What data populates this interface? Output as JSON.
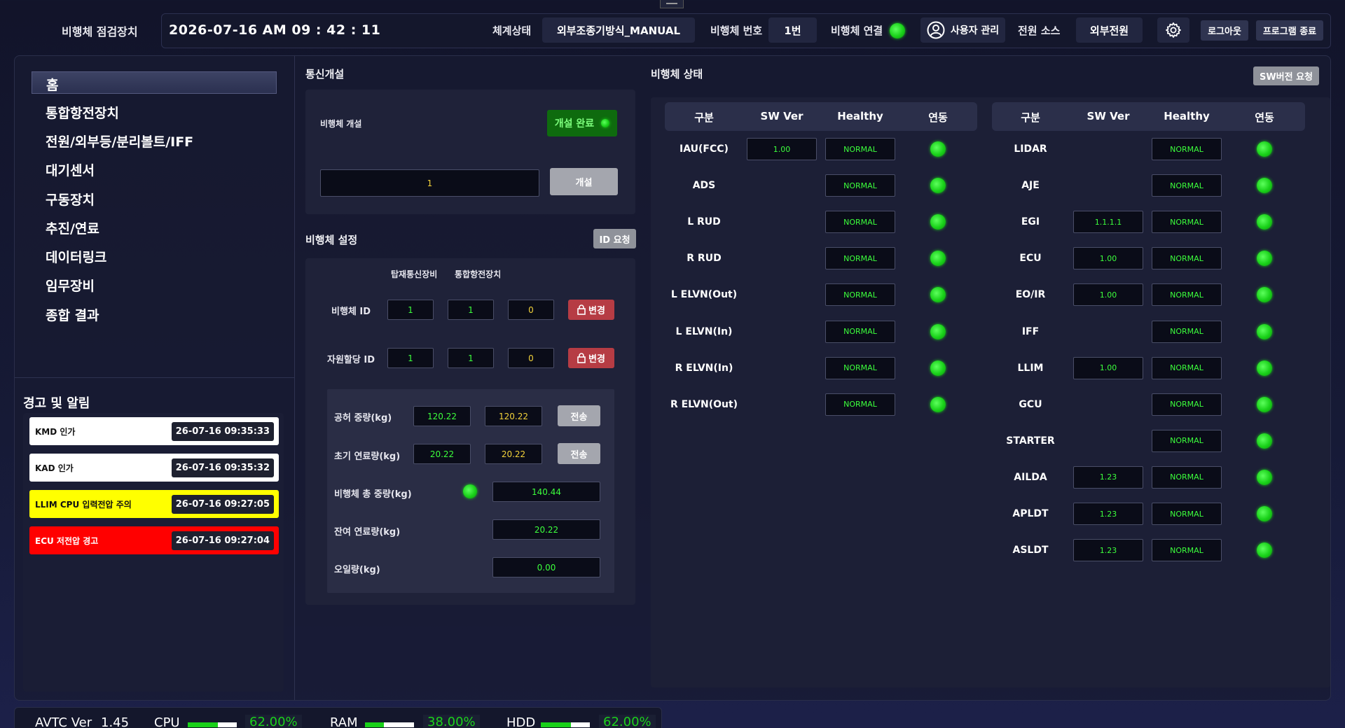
{
  "header": {
    "app_title": "비행체 점검장치",
    "datetime": "2026-07-16   AM 09 : 42 : 11",
    "system_state_label": "체계상태",
    "system_state_value": "외부조종기방식_MANUAL",
    "vehicle_no_label": "비행체 번호",
    "vehicle_no_value": "1번",
    "vehicle_link_label": "비행체 연결",
    "user_mgmt_label": "사용자 관리",
    "power_source_label": "전원 소스",
    "power_source_value": "외부전원",
    "logout_label": "로그아웃",
    "exit_label": "프로그램 종료"
  },
  "sidebar": {
    "items": [
      {
        "label": "홈"
      },
      {
        "label": "통합항전장치"
      },
      {
        "label": "전원/외부등/분리볼트/IFF"
      },
      {
        "label": "대기센서"
      },
      {
        "label": "구동장치"
      },
      {
        "label": "추진/연료"
      },
      {
        "label": "데이터링크"
      },
      {
        "label": "임무장비"
      },
      {
        "label": "종합 결과"
      }
    ]
  },
  "alerts": {
    "title": "경고 및 알림",
    "items": [
      {
        "text": "KMD 인가",
        "time": "26-07-16 09:35:33",
        "level": "white"
      },
      {
        "text": "KAD 인가",
        "time": "26-07-16 09:35:32",
        "level": "white"
      },
      {
        "text": "LLIM CPU 입력전압 주의",
        "time": "26-07-16 09:27:05",
        "level": "yellow"
      },
      {
        "text": "ECU 저전압 경고",
        "time": "26-07-16 09:27:04",
        "level": "red"
      }
    ]
  },
  "comm": {
    "title": "통신개설",
    "vehicle_open_label": "비행체 개설",
    "status_label": "개설 완료",
    "input_value": "1",
    "open_button": "개설"
  },
  "vehicle_setup": {
    "title": "비행체 설정",
    "id_request_button": "ID 요청",
    "col1_header": "탑재통신장비",
    "col2_header": "통합항전장치",
    "vehicle_id_label": "비행체 ID",
    "vehicle_id_values": [
      "1",
      "1",
      "0"
    ],
    "resource_id_label": "자원할당 ID",
    "resource_id_values": [
      "1",
      "1",
      "0"
    ],
    "change_button": "변경",
    "empty_weight_label": "공허 중량(kg)",
    "empty_weight_values": [
      "120.22",
      "120.22"
    ],
    "init_fuel_label": "초기 연료량(kg)",
    "init_fuel_values": [
      "20.22",
      "20.22"
    ],
    "send_button": "전송",
    "total_weight_label": "비행체 총 중량(kg)",
    "total_weight_value": "140.44",
    "remaining_fuel_label": "잔여 연료량(kg)",
    "remaining_fuel_value": "20.22",
    "oil_label": "오일량(kg)",
    "oil_value": "0.00"
  },
  "vehicle_status": {
    "title": "비행체 상태",
    "sw_request_button": "SW버전 요청",
    "headers": [
      "구분",
      "SW Ver",
      "Healthy",
      "연동"
    ],
    "left_rows": [
      {
        "name": "IAU(FCC)",
        "sw": "1.00",
        "health": "NORMAL"
      },
      {
        "name": "ADS",
        "sw": "",
        "health": "NORMAL"
      },
      {
        "name": "L RUD",
        "sw": "",
        "health": "NORMAL"
      },
      {
        "name": "R RUD",
        "sw": "",
        "health": "NORMAL"
      },
      {
        "name": "L ELVN(Out)",
        "sw": "",
        "health": "NORMAL"
      },
      {
        "name": "L ELVN(In)",
        "sw": "",
        "health": "NORMAL"
      },
      {
        "name": "R ELVN(In)",
        "sw": "",
        "health": "NORMAL"
      },
      {
        "name": "R ELVN(Out)",
        "sw": "",
        "health": "NORMAL"
      }
    ],
    "right_rows": [
      {
        "name": "LIDAR",
        "sw": "",
        "health": "NORMAL"
      },
      {
        "name": "AJE",
        "sw": "",
        "health": "NORMAL"
      },
      {
        "name": "EGI",
        "sw": "1.1.1.1",
        "health": "NORMAL"
      },
      {
        "name": "ECU",
        "sw": "1.00",
        "health": "NORMAL"
      },
      {
        "name": "EO/IR",
        "sw": "1.00",
        "health": "NORMAL"
      },
      {
        "name": "IFF",
        "sw": "",
        "health": "NORMAL"
      },
      {
        "name": "LLIM",
        "sw": "1.00",
        "health": "NORMAL"
      },
      {
        "name": "GCU",
        "sw": "",
        "health": "NORMAL"
      },
      {
        "name": "STARTER",
        "sw": "",
        "health": "NORMAL"
      },
      {
        "name": "AILDA",
        "sw": "1.23",
        "health": "NORMAL"
      },
      {
        "name": "APLDT",
        "sw": "1.23",
        "health": "NORMAL"
      },
      {
        "name": "ASLDT",
        "sw": "1.23",
        "health": "NORMAL"
      }
    ]
  },
  "footer": {
    "avtc_label": "AVTC Ver",
    "avtc_value": "1.45",
    "cpu_label": "CPU",
    "cpu_value": "62.00%",
    "cpu_fraction": 0.62,
    "ram_label": "RAM",
    "ram_value": "38.00%",
    "ram_fraction": 0.38,
    "hdd_label": "HDD",
    "hdd_value": "62.00%",
    "hdd_fraction": 0.62
  },
  "colors": {
    "accent_green": "#19d119",
    "alert_yellow": "#ffff00",
    "alert_red": "#ff0000",
    "change_button": "#b63c44"
  }
}
